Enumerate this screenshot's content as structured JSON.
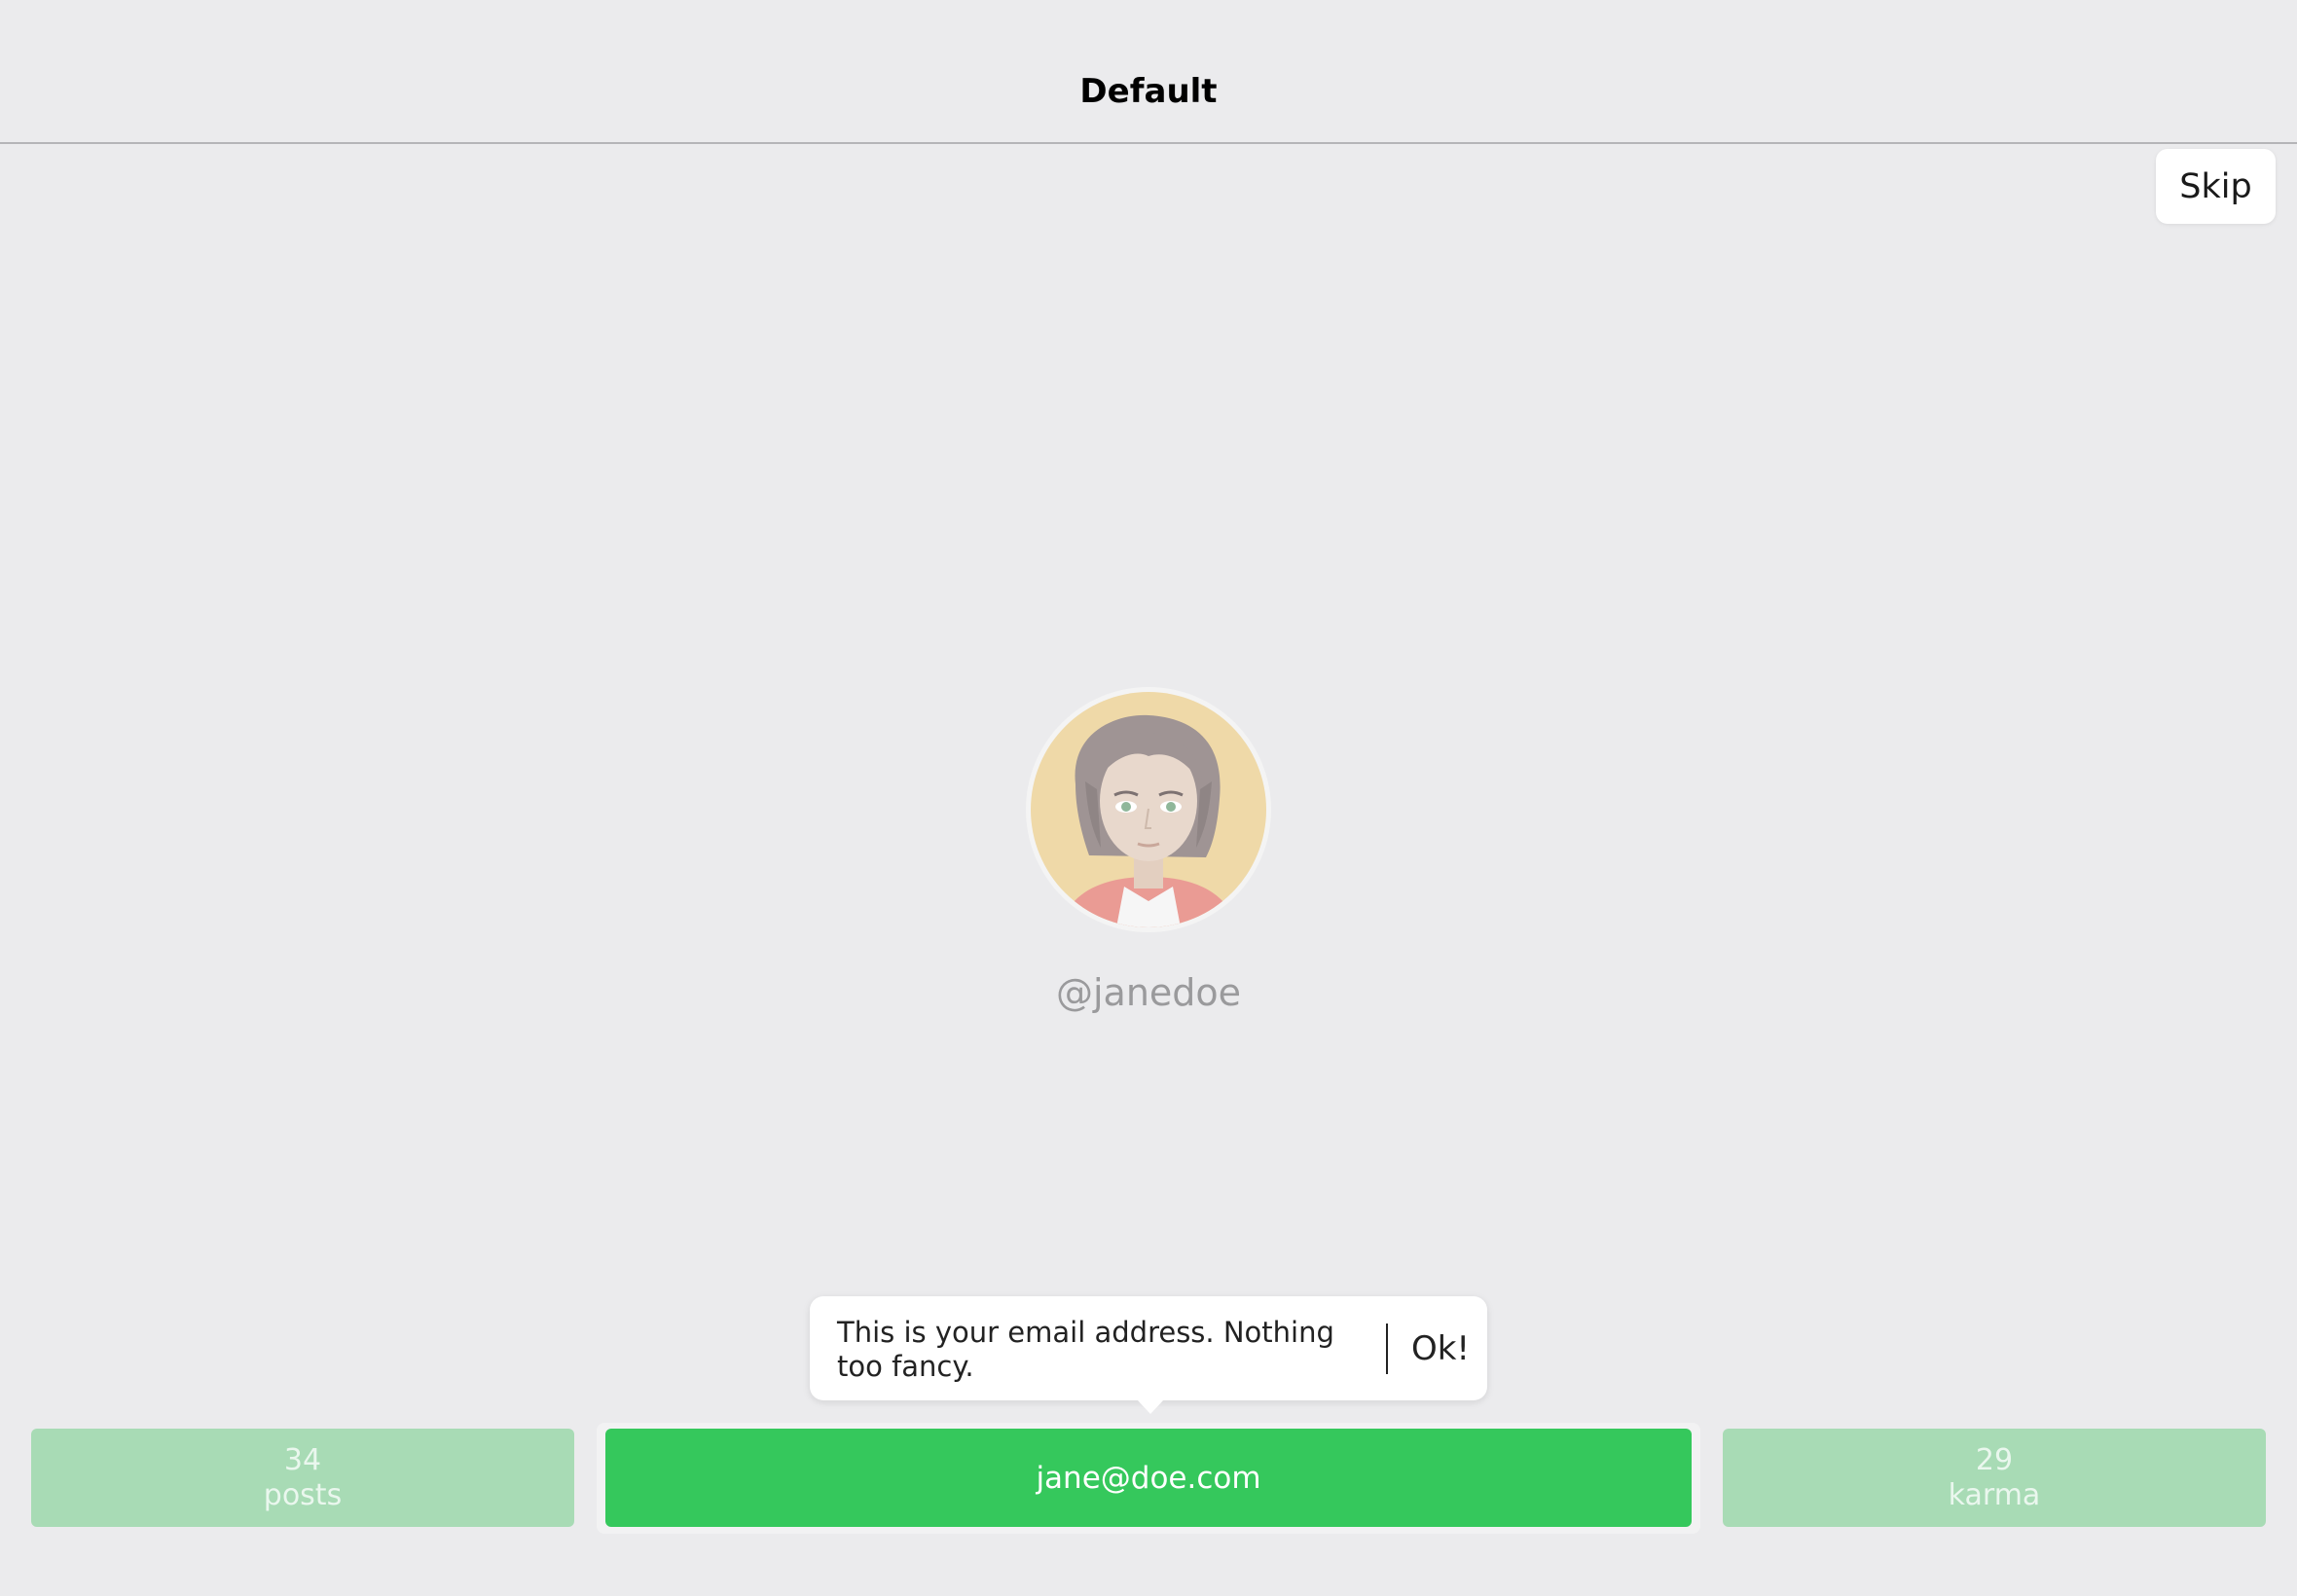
{
  "nav": {
    "title": "Default"
  },
  "skip": {
    "label": "Skip"
  },
  "profile": {
    "username": "@janedoe"
  },
  "stats": {
    "posts": {
      "value": "34",
      "label": "posts"
    },
    "email": "jane@doe.com",
    "karma": {
      "value": "29",
      "label": "karma"
    }
  },
  "tooltip": {
    "text": "This is your email address. Nothing too fancy.",
    "ok_label": "Ok!"
  },
  "colors": {
    "background": "#ebebed",
    "accent_green": "#35c85c",
    "dimmed_green": "#a8dbb5"
  }
}
